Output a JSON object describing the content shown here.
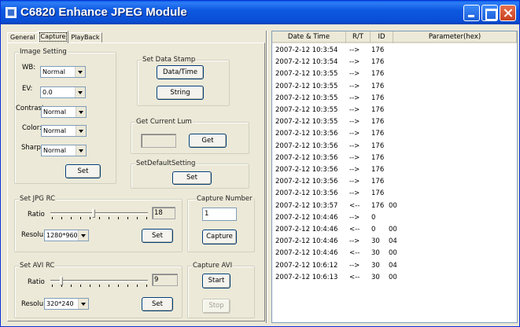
{
  "window": {
    "title": "C6820 Enhance JPEG Module"
  },
  "tabs": [
    {
      "label": "General",
      "active": false
    },
    {
      "label": "Capture",
      "active": true
    },
    {
      "label": "PlayBack",
      "active": false
    }
  ],
  "image_setting": {
    "title": "Image Setting",
    "wb": {
      "label": "WB:",
      "value": "Normal"
    },
    "ev": {
      "label": "EV:",
      "value": "0.0"
    },
    "contrast": {
      "label": "Contrast:",
      "value": "Normal"
    },
    "color": {
      "label": "Color:",
      "value": "Normal"
    },
    "sharp": {
      "label": "Sharp:",
      "value": "Normal"
    },
    "set_label": "Set"
  },
  "data_stamp": {
    "title": "Set Data Stamp",
    "datetime_label": "Data/Time",
    "string_label": "String"
  },
  "current_lum": {
    "title": "Get Current Lum",
    "value": "",
    "get_label": "Get"
  },
  "default_setting": {
    "title": "SetDefaultSetting",
    "set_label": "Set"
  },
  "jpg_rc": {
    "title": "Set JPG RC",
    "ratio_label": "Ratio",
    "ratio_value": "18",
    "ratio_level": 0.45,
    "resolu_label": "Resolu",
    "resolu_value": "1280*960",
    "set_label": "Set"
  },
  "capture_number": {
    "title": "Capture  Number",
    "value": "1",
    "capture_label": "Capture"
  },
  "avi_rc": {
    "title": "Set AVI RC",
    "ratio_label": "Ratio",
    "ratio_value": "9",
    "ratio_level": 0.1,
    "resolu_label": "Resolu",
    "resolu_value": "320*240",
    "set_label": "Set"
  },
  "capture_avi": {
    "title": "Capture AVI",
    "start_label": "Start",
    "stop_label": "Stop"
  },
  "log": {
    "columns": [
      "Date & Time",
      "R/T",
      "ID",
      "Parameter(hex)"
    ],
    "rows": [
      {
        "time": "2007-2-12  10:3:54",
        "rt": "-->",
        "id": "176",
        "param": ""
      },
      {
        "time": "2007-2-12  10:3:54",
        "rt": "-->",
        "id": "176",
        "param": ""
      },
      {
        "time": "2007-2-12  10:3:55",
        "rt": "-->",
        "id": "176",
        "param": ""
      },
      {
        "time": "2007-2-12  10:3:55",
        "rt": "-->",
        "id": "176",
        "param": ""
      },
      {
        "time": "2007-2-12  10:3:55",
        "rt": "-->",
        "id": "176",
        "param": ""
      },
      {
        "time": "2007-2-12  10:3:55",
        "rt": "-->",
        "id": "176",
        "param": ""
      },
      {
        "time": "2007-2-12  10:3:55",
        "rt": "-->",
        "id": "176",
        "param": ""
      },
      {
        "time": "2007-2-12  10:3:56",
        "rt": "-->",
        "id": "176",
        "param": ""
      },
      {
        "time": "2007-2-12  10:3:56",
        "rt": "-->",
        "id": "176",
        "param": ""
      },
      {
        "time": "2007-2-12  10:3:56",
        "rt": "-->",
        "id": "176",
        "param": ""
      },
      {
        "time": "2007-2-12  10:3:56",
        "rt": "-->",
        "id": "176",
        "param": ""
      },
      {
        "time": "2007-2-12  10:3:56",
        "rt": "-->",
        "id": "176",
        "param": ""
      },
      {
        "time": "2007-2-12  10:3:56",
        "rt": "-->",
        "id": "176",
        "param": ""
      },
      {
        "time": "2007-2-12  10:3:57",
        "rt": "<--",
        "id": "176",
        "param": "00"
      },
      {
        "time": "2007-2-12  10:4:46",
        "rt": "-->",
        "id": "0",
        "param": ""
      },
      {
        "time": "2007-2-12  10:4:46",
        "rt": "<--",
        "id": "0",
        "param": "00"
      },
      {
        "time": "2007-2-12  10:4:46",
        "rt": "-->",
        "id": "30",
        "param": "04"
      },
      {
        "time": "2007-2-12  10:4:46",
        "rt": "<--",
        "id": "30",
        "param": "00"
      },
      {
        "time": "2007-2-12  10:6:12",
        "rt": "-->",
        "id": "30",
        "param": "04"
      },
      {
        "time": "2007-2-12  10:6:13",
        "rt": "<--",
        "id": "30",
        "param": "00"
      }
    ]
  }
}
